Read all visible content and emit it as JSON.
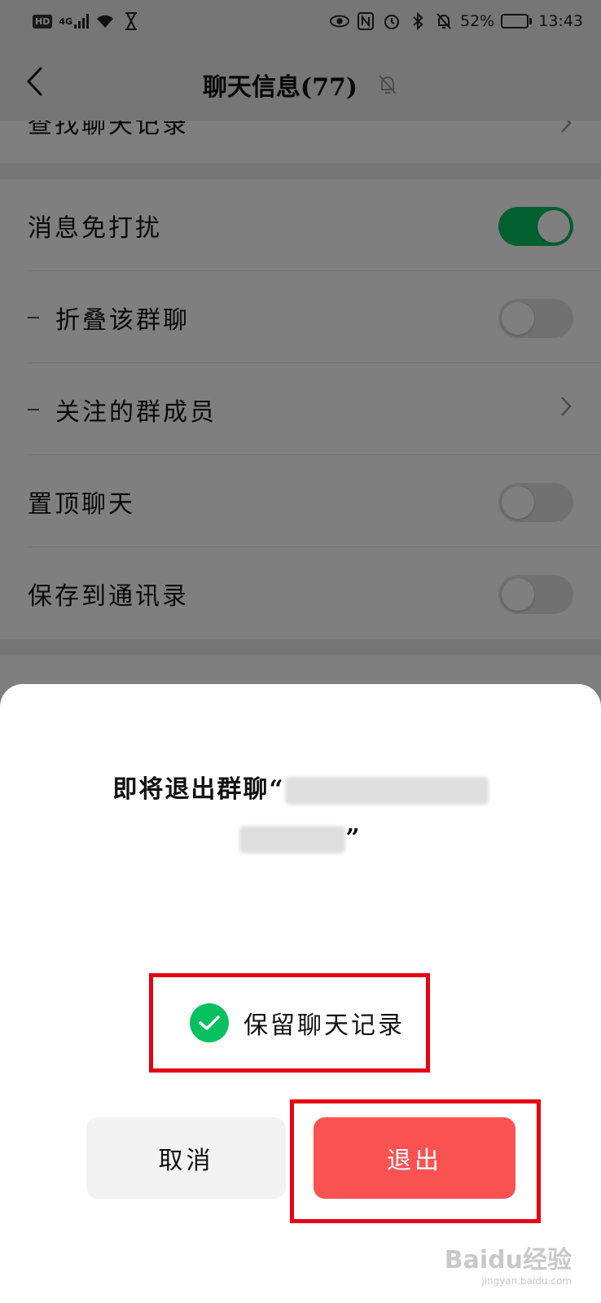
{
  "status_bar": {
    "hd": "HD",
    "network": "4G",
    "battery_percent": "52%",
    "battery_level": 0.52,
    "time": "13:43"
  },
  "nav": {
    "title": "聊天信息(77)",
    "icons": [
      "back-icon",
      "bell-muted-icon"
    ]
  },
  "settings": {
    "search_history_label": "查找聊天记录",
    "rows": [
      {
        "label": "消息免打扰",
        "control": "toggle",
        "on": true,
        "sub": false
      },
      {
        "label": "折叠该群聊",
        "control": "toggle",
        "on": false,
        "sub": true
      },
      {
        "label": "关注的群成员",
        "control": "chevron",
        "sub": true
      },
      {
        "label": "置顶聊天",
        "control": "toggle",
        "on": false,
        "sub": false
      },
      {
        "label": "保存到通讯录",
        "control": "toggle",
        "on": false,
        "sub": false
      }
    ]
  },
  "dialog": {
    "title_prefix": "即将退出群聊“",
    "title_suffix": "”",
    "keep_history_label": "保留聊天记录",
    "keep_history_checked": true,
    "cancel_label": "取消",
    "exit_label": "退出",
    "colors": {
      "primary_green": "#07c160",
      "danger_red": "#fa5151",
      "highlight_red": "#e60012"
    }
  },
  "watermark": {
    "text": "Baidu经验",
    "sub": "jingyan.baidu.com"
  }
}
